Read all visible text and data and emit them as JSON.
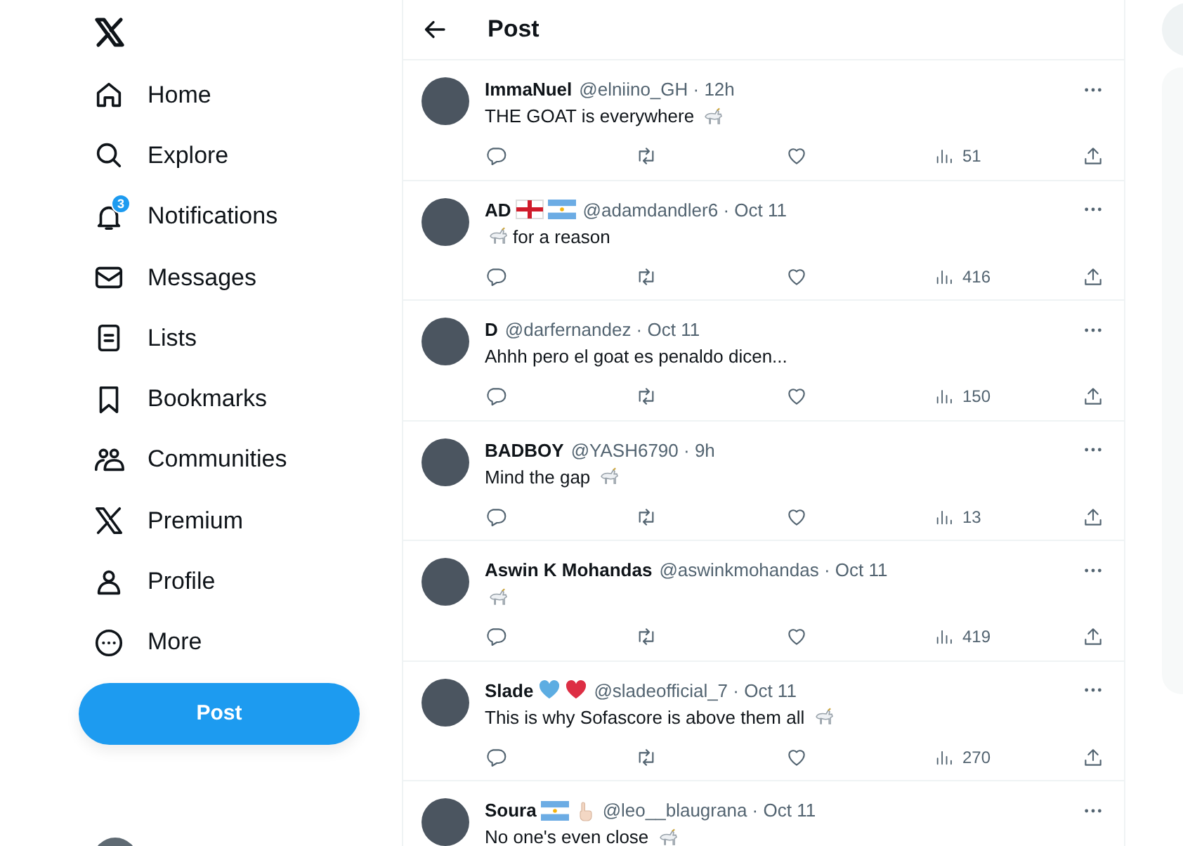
{
  "sidebar": {
    "items": [
      {
        "kind": "home",
        "label": "Home"
      },
      {
        "kind": "search",
        "label": "Explore"
      },
      {
        "kind": "bell",
        "label": "Notifications",
        "badge": "3"
      },
      {
        "kind": "mail",
        "label": "Messages"
      },
      {
        "kind": "list",
        "label": "Lists"
      },
      {
        "kind": "bookmark",
        "label": "Bookmarks"
      },
      {
        "kind": "people",
        "label": "Communities"
      },
      {
        "kind": "x",
        "label": "Premium"
      },
      {
        "kind": "person",
        "label": "Profile"
      },
      {
        "kind": "more",
        "label": "More"
      }
    ],
    "post_button": "Post"
  },
  "header": {
    "title": "Post"
  },
  "tweets": [
    {
      "name": "ImmaNuel",
      "meta": "@elniino_GH · 12h",
      "body": [
        {
          "kind": "text",
          "text": "THE GOAT is everywhere"
        },
        {
          "kind": "goat"
        }
      ],
      "views": "51"
    },
    {
      "name": "AD",
      "name_emoji": [
        {
          "kind": "england"
        },
        {
          "kind": "argentina"
        }
      ],
      "meta": "@adamdandler6 · Oct 11",
      "body": [
        {
          "kind": "goat"
        },
        {
          "kind": "text",
          "text": "for a reason"
        }
      ],
      "views": "416"
    },
    {
      "name": "D",
      "meta": "@darfernandez · Oct 11",
      "body": [
        {
          "kind": "text",
          "text": "Ahhh pero el goat es penaldo dicen..."
        }
      ],
      "views": "150"
    },
    {
      "name": "BADBOY",
      "meta": "@YASH6790 · 9h",
      "body": [
        {
          "kind": "text",
          "text": "Mind the gap"
        },
        {
          "kind": "goat"
        }
      ],
      "views": "13"
    },
    {
      "name": "Aswin K Mohandas",
      "meta": "@aswinkmohandas · Oct 11",
      "body": [
        {
          "kind": "goat"
        }
      ],
      "views": "419"
    },
    {
      "name": "Slade",
      "name_emoji": [
        {
          "kind": "blueheart"
        },
        {
          "kind": "redheart"
        }
      ],
      "meta": "@sladeofficial_7 · Oct 11",
      "body": [
        {
          "kind": "text",
          "text": "This is why Sofascore is above them all"
        },
        {
          "kind": "goat"
        }
      ],
      "views": "270"
    },
    {
      "name": "Soura",
      "name_emoji": [
        {
          "kind": "argentina"
        },
        {
          "kind": "finger"
        }
      ],
      "meta": "@leo__blaugrana · Oct 11",
      "body": [
        {
          "kind": "text",
          "text": "No one's even close"
        },
        {
          "kind": "goat"
        }
      ]
    }
  ]
}
